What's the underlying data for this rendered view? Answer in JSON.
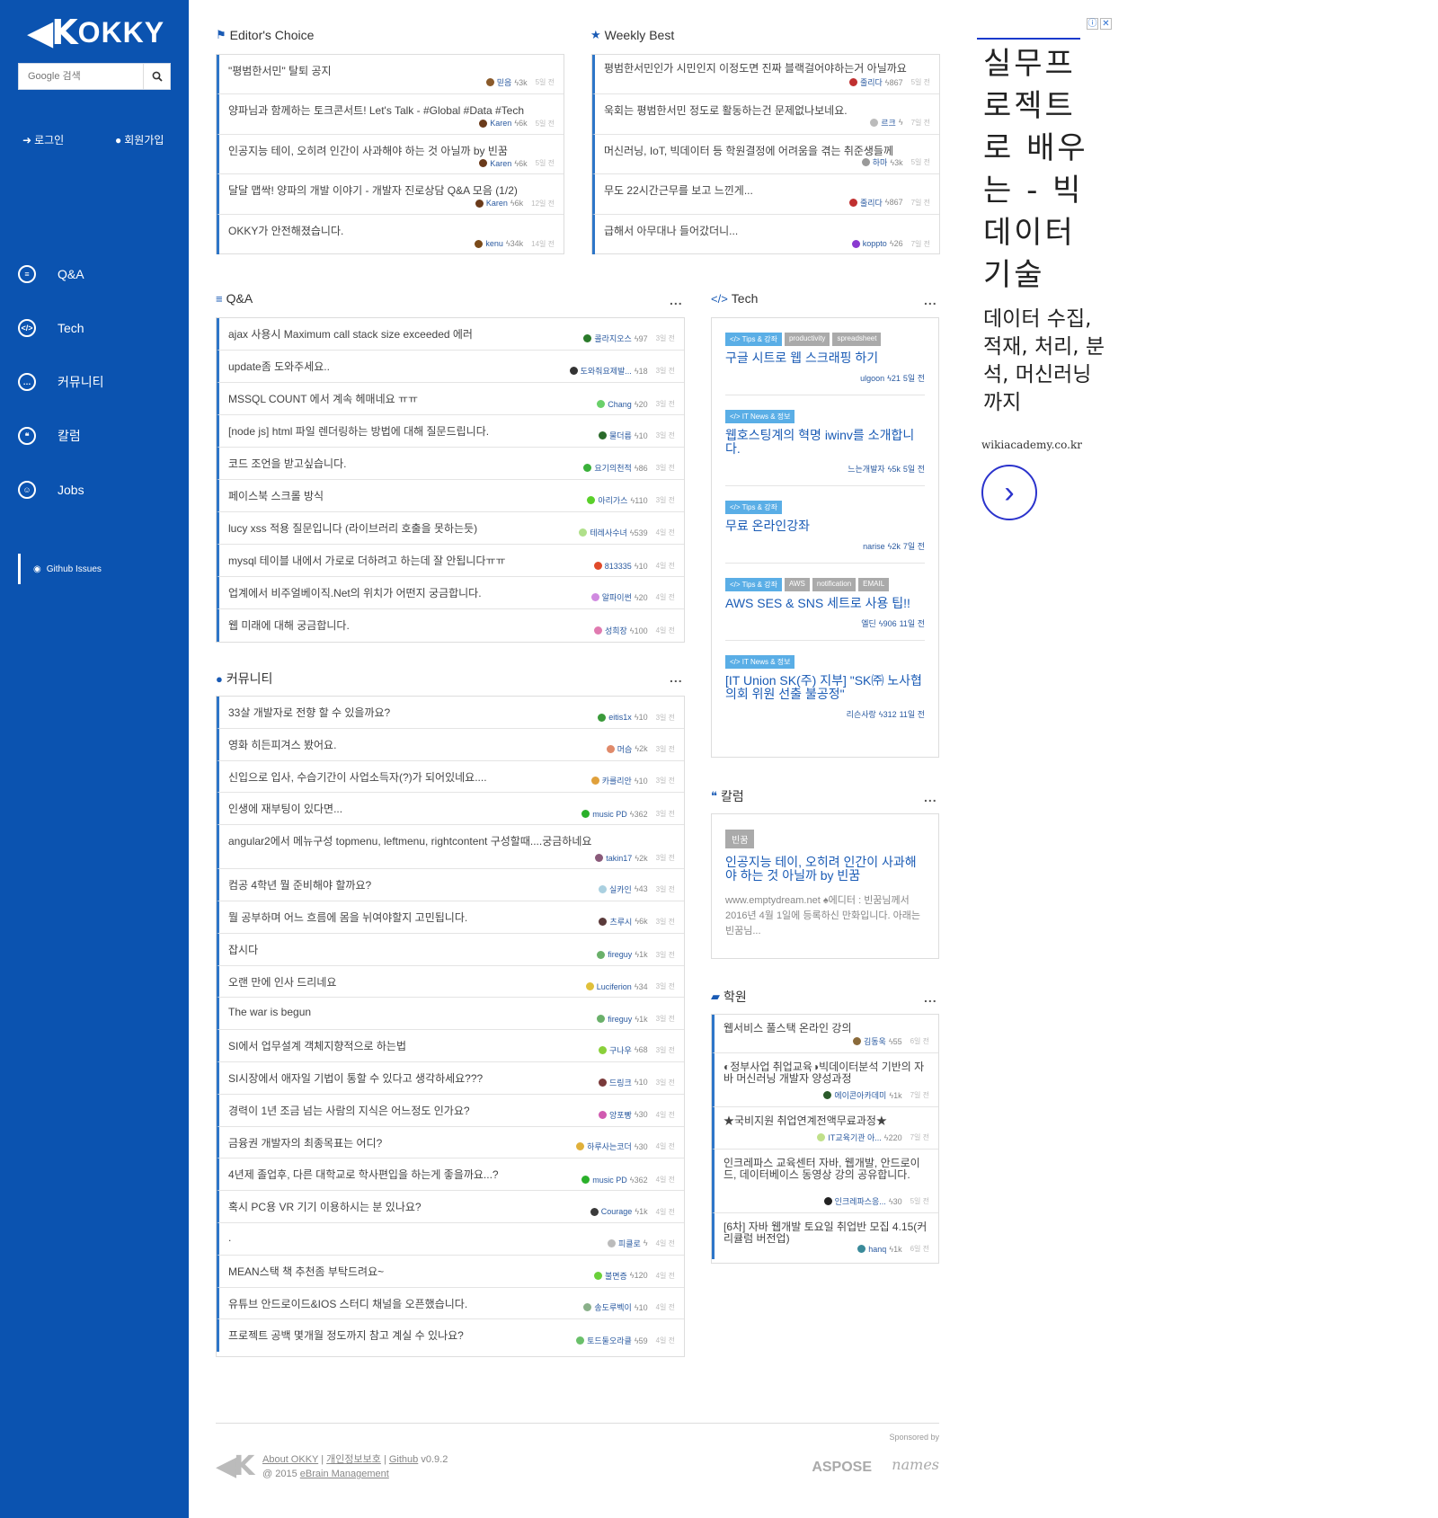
{
  "brand": {
    "logo_mark": "◀K",
    "logo_text": "OKKY"
  },
  "search": {
    "placeholder": "Google 검색",
    "button_icon": "search-icon"
  },
  "auth": {
    "login": "로그인",
    "signup": "회원가입"
  },
  "nav": [
    {
      "label": "Q&A",
      "icon": "database-icon"
    },
    {
      "label": "Tech",
      "icon": "code-icon"
    },
    {
      "label": "커뮤니티",
      "icon": "comment-icon"
    },
    {
      "label": "칼럼",
      "icon": "quote-icon"
    },
    {
      "label": "Jobs",
      "icon": "group-icon"
    }
  ],
  "github_link": "Github Issues",
  "editors_choice": {
    "title": "Editor's Choice",
    "items": [
      {
        "title": "\"평범한서민\" 탈퇴 공지",
        "user": "믿음",
        "score": "3k",
        "time": "5일 전",
        "color": "#8a5a2a"
      },
      {
        "title": "양파님과 함께하는 토크콘서트! Let's Talk - #Global #Data #Tech",
        "user": "Karen",
        "score": "6k",
        "time": "5일 전",
        "color": "#6a3a1a"
      },
      {
        "title": "인공지능 테이, 오히려 인간이 사과해야 하는 것 아닐까 by 빈꿈",
        "user": "Karen",
        "score": "6k",
        "time": "5일 전",
        "color": "#6a3a1a"
      },
      {
        "title": "달달 맵싹! 양파의 개발 이야기 - 개발자 진로상담 Q&A 모음 (1/2)",
        "user": "Karen",
        "score": "6k",
        "time": "12일 전",
        "color": "#6a3a1a"
      },
      {
        "title": "OKKY가 안전해졌습니다.",
        "user": "kenu",
        "score": "34k",
        "time": "14일 전",
        "color": "#7a4a1a"
      }
    ]
  },
  "weekly_best": {
    "title": "Weekly Best",
    "items": [
      {
        "title": "평범한서민인가 시민인지 이정도면 진짜 블랙걸어야하는거 아닐까요",
        "user": "줄리다",
        "score": "867",
        "time": "5일 전",
        "color": "#c03030"
      },
      {
        "title": "욱회는 평범한서민 정도로 활동하는건 문제없나보네요.",
        "user": "르크",
        "score": "",
        "time": "7일 전",
        "color": "#bbbbbb"
      },
      {
        "title": "머신러닝, IoT, 빅데이터 등 학원결정에 어려움을 겪는 취준생들께",
        "user": "하마",
        "score": "3k",
        "time": "5일 전",
        "color": "#999999"
      },
      {
        "title": "무도 22시간근무를 보고 느낀게...",
        "user": "줄리다",
        "score": "867",
        "time": "7일 전",
        "color": "#c03030"
      },
      {
        "title": "급해서 아무대나 들어갔더니...",
        "user": "koppto",
        "score": "26",
        "time": "7일 전",
        "color": "#8a3ad0"
      }
    ]
  },
  "qa": {
    "title": "Q&A",
    "more": "...",
    "items": [
      {
        "title": "ajax 사용시 Maximum call stack size exceeded 에러",
        "user": "콜라지오스",
        "score": "97",
        "time": "3일 전",
        "color": "#2a7a2a"
      },
      {
        "title": "update좀 도와주세요..",
        "user": "도와줘요제발...",
        "score": "18",
        "time": "3일 전",
        "color": "#333333"
      },
      {
        "title": "MSSQL COUNT 에서 계속 헤매네요 ㅠㅠ",
        "user": "Chang",
        "score": "20",
        "time": "3일 전",
        "color": "#6ad06a"
      },
      {
        "title": "[node js] html 파일 렌더링하는 방법에 대해 질문드립니다.",
        "user": "물더름",
        "score": "10",
        "time": "3일 전",
        "color": "#2a6a2a"
      },
      {
        "title": "코드 조언을 받고싶습니다.",
        "user": "요기의천적",
        "score": "86",
        "time": "3일 전",
        "color": "#3ab03a"
      },
      {
        "title": "페이스북 스크롤 방식",
        "user": "아리가스",
        "score": "110",
        "time": "3일 전",
        "color": "#5ad02a"
      },
      {
        "title": "lucy xss 적용 질문입니다 (라이브러리 호출을 못하는듯)",
        "user": "테레사수녀",
        "score": "539",
        "time": "4일 전",
        "color": "#b0e08a"
      },
      {
        "title": "mysql 테이블 내에서 가로로 더하려고 하는데 잘 안됩니다ㅠㅠ",
        "user": "813335",
        "score": "10",
        "time": "4일 전",
        "color": "#e04a2a"
      },
      {
        "title": "업계에서 비주얼베이직.Net의 위치가 어떤지 궁금합니다.",
        "user": "알파이썬",
        "score": "20",
        "time": "4일 전",
        "color": "#d08ae0"
      },
      {
        "title": "웹 미래에 대해 궁금합니다.",
        "user": "성희장",
        "score": "100",
        "time": "4일 전",
        "color": "#e07ab0"
      }
    ]
  },
  "community": {
    "title": "커뮤니티",
    "more": "...",
    "items": [
      {
        "title": "33살 개발자로 전향 할 수 있을까요?",
        "user": "eitis1x",
        "score": "10",
        "time": "3일 전",
        "color": "#3a9a3a"
      },
      {
        "title": "영화 히든피겨스 봤어요.",
        "user": "머슴",
        "score": "2k",
        "time": "3일 전",
        "color": "#e08a6a"
      },
      {
        "title": "신입으로 입사, 수습기간이 사업소득자(?)가 되어있네요....",
        "user": "카를리안",
        "score": "10",
        "time": "3일 전",
        "color": "#e0a03a"
      },
      {
        "title": "인생에 재부팅이 있다면...",
        "user": "music PD",
        "score": "362",
        "time": "3일 전",
        "color": "#2ab02a"
      },
      {
        "title": "angular2에서 메뉴구성 topmenu, leftmenu, rightcontent 구성할때....궁금하네요",
        "user": "takin17",
        "score": "2k",
        "time": "3일 전",
        "color": "#8a5a7a"
      },
      {
        "title": "컴공 4학년 뭘 준비해야 할까요?",
        "user": "실카인",
        "score": "43",
        "time": "3일 전",
        "color": "#aad0e0"
      },
      {
        "title": "뭘 공부하며 어느 흐름에 몸을 뉘여야할지 고민됩니다.",
        "user": "츠루시",
        "score": "6k",
        "time": "3일 전",
        "color": "#5a3a3a"
      },
      {
        "title": "잡시다",
        "user": "fireguy",
        "score": "1k",
        "time": "3일 전",
        "color": "#6ab06a"
      },
      {
        "title": "오랜 만에 인사 드리네요",
        "user": "Luciferion",
        "score": "34",
        "time": "3일 전",
        "color": "#e0c03a"
      },
      {
        "title": "The war is begun",
        "user": "fireguy",
        "score": "1k",
        "time": "3일 전",
        "color": "#6ab06a"
      },
      {
        "title": "SI에서 업무설계 객체지향적으로 하는법",
        "user": "구나우",
        "score": "68",
        "time": "3일 전",
        "color": "#8ad03a"
      },
      {
        "title": "SI시장에서 애자일 기법이 통할 수 있다고 생각하세요???",
        "user": "드링크",
        "score": "10",
        "time": "3일 전",
        "color": "#7a3a3a"
      },
      {
        "title": "경력이 1년 조금 넘는 사람의 지식은 어느정도 인가요?",
        "user": "앙포빵",
        "score": "30",
        "time": "4일 전",
        "color": "#d05ab0"
      },
      {
        "title": "금융권 개발자의 최종목표는 어디?",
        "user": "하루사는코더",
        "score": "30",
        "time": "4일 전",
        "color": "#e0b03a"
      },
      {
        "title": "4년제 졸업후, 다른 대학교로 학사편입을 하는게 좋을까요...?",
        "user": "music PD",
        "score": "362",
        "time": "4일 전",
        "color": "#2ab02a"
      },
      {
        "title": "혹시 PC용 VR 기기 이용하시는 분 있나요?",
        "user": "Courage",
        "score": "1k",
        "time": "4일 전",
        "color": "#3a3a3a"
      },
      {
        "title": ".",
        "user": "피클로",
        "score": "",
        "time": "4일 전",
        "color": "#bbbbbb"
      },
      {
        "title": "MEAN스택 책 추천좀 부탁드려요~",
        "user": "불면증",
        "score": "120",
        "time": "4일 전",
        "color": "#6ad03a"
      },
      {
        "title": "유튜브 안드로이드&IOS 스터디 채널을 오픈했습니다.",
        "user": "송도루벡이",
        "score": "10",
        "time": "4일 전",
        "color": "#8ab08a"
      },
      {
        "title": "프로젝트 공백 몇개월 정도까지 참고 계실 수 있나요?",
        "user": "토드둘오라클",
        "score": "59",
        "time": "4일 전",
        "color": "#6ac06a"
      }
    ]
  },
  "tech": {
    "title": "Tech",
    "more": "...",
    "items": [
      {
        "tags": [
          {
            "t": "</> Tips & 강좌",
            "blue": true
          },
          {
            "t": "productivity",
            "blue": false
          },
          {
            "t": "spreadsheet",
            "blue": false
          }
        ],
        "title": "구글 시트로 웹 스크래핑 하기",
        "user": "ulgoon",
        "score": "21",
        "time": "5일 전",
        "color": "#e05a3a"
      },
      {
        "tags": [
          {
            "t": "</> IT News & 정보",
            "blue": true
          }
        ],
        "title": "웹호스팅계의 혁명 iwinv를 소개합니다.",
        "user": "느는개발자",
        "score": "5k",
        "time": "5일 전",
        "color": "#5a8ae0"
      },
      {
        "tags": [
          {
            "t": "</> Tips & 강좌",
            "blue": true
          }
        ],
        "title": "무료 온라인강좌",
        "user": "narise",
        "score": "2k",
        "time": "7일 전",
        "color": "#e0b03a"
      },
      {
        "tags": [
          {
            "t": "</> Tips & 강좌",
            "blue": true
          },
          {
            "t": "AWS",
            "blue": false
          },
          {
            "t": "notification",
            "blue": false
          },
          {
            "t": "EMAIL",
            "blue": false
          }
        ],
        "title": "AWS SES & SNS 세트로 사용 팁!!",
        "user": "엘딘",
        "score": "906",
        "time": "11일 전",
        "color": "#d05ab0"
      },
      {
        "tags": [
          {
            "t": "</> IT News & 정보",
            "blue": true
          }
        ],
        "title": "[IT Union SK(주) 지부] \"SK㈜ 노사협의회 위원 선출 불공정\"",
        "user": "리슨사랑",
        "score": "312",
        "time": "11일 전",
        "color": "#6ab06a"
      }
    ]
  },
  "column": {
    "title": "칼럼",
    "more": "...",
    "tag": "빈꿈",
    "title_text": "인공지능 테이, 오히려 인간이 사과해야 하는 것 아닐까 by 빈꿈",
    "excerpt": "www.emptydream.net ♠에디터 : 빈꿈님께서 2016년 4월 1일에 등록하신 만화입니다. 아래는 빈꿈님..."
  },
  "academy": {
    "title": "학원",
    "more": "...",
    "items": [
      {
        "title": "웹서비스 풀스택 온라인 강의",
        "user": "김동욱",
        "score": "55",
        "time": "6일 전",
        "color": "#8a6a3a"
      },
      {
        "title": "◐정부사업 취업교육◑빅데이터분석 기반의 자바 머신러닝 개발자 양성과정",
        "user": "에이콘아카데미",
        "score": "1k",
        "time": "7일 전",
        "color": "#2a5a2a"
      },
      {
        "title": "★국비지원 취업연계전액무료과정★",
        "user": "IT교육기관 아...",
        "score": "220",
        "time": "7일 전",
        "color": "#c0e08a"
      },
      {
        "title": "인크레파스 교육센터 자바, 웹개발, 안드로이드, 데이터베이스 동영상 강의 공유합니다.",
        "user": "인크레파스응...",
        "score": "30",
        "time": "5일 전",
        "color": "#222222"
      },
      {
        "title": "[6차] 자바 웹개발 토요일 취업반 모집 4.15(커리큘럼 버전업)",
        "user": "hanq",
        "score": "1k",
        "time": "6일 전",
        "color": "#3a8a9a"
      }
    ]
  },
  "ad": {
    "headline": "실무프로젝트로 배우는 - 빅데이터 기술",
    "sub": "데이터 수집, 적재, 처리, 분석, 머신러닝까지",
    "url": "wikiacademy.co.kr",
    "arrow": "›",
    "info": "ⓘ",
    "close": "✕"
  },
  "footer": {
    "about": "About OKKY",
    "privacy": "개인정보보호",
    "github": "Github",
    "version": "v0.9.2",
    "copy": "@ 2015",
    "company": "eBrain Management",
    "sponsored": "Sponsored by",
    "sponsor1": "ASPOSE",
    "sponsor2": "names"
  }
}
